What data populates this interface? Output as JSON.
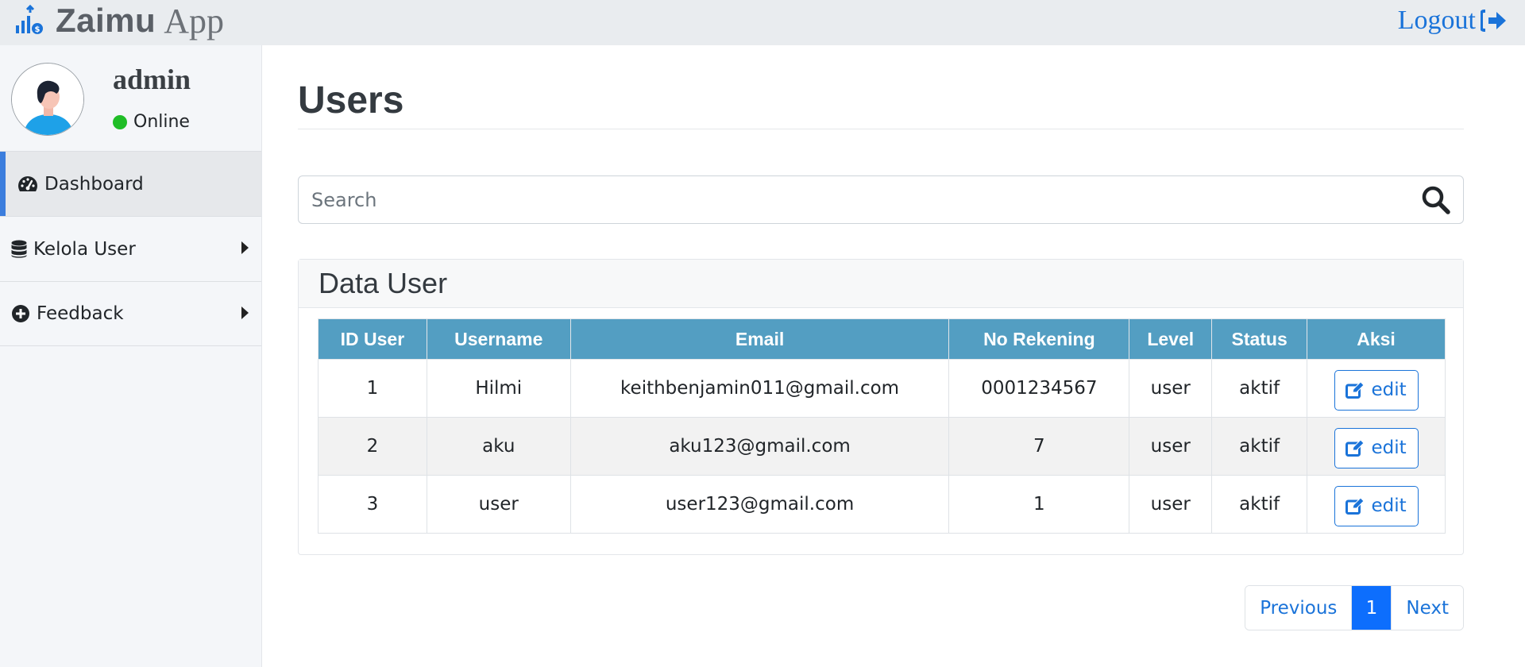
{
  "header": {
    "brand_name": "Zaimu",
    "brand_suffix": "App",
    "logout_label": "Logout"
  },
  "profile": {
    "name": "admin",
    "status": "Online"
  },
  "sidebar": {
    "items": [
      {
        "label": "Dashboard",
        "icon": "dashboard-icon",
        "active": true
      },
      {
        "label": "Kelola User",
        "icon": "database-icon",
        "active": false
      },
      {
        "label": "Feedback",
        "icon": "plus-circle-icon",
        "active": false
      }
    ]
  },
  "main": {
    "title": "Users",
    "search": {
      "placeholder": "Search"
    },
    "card_title": "Data User",
    "table": {
      "headers": [
        "ID User",
        "Username",
        "Email",
        "No Rekening",
        "Level",
        "Status",
        "Aksi"
      ],
      "rows": [
        {
          "id": "1",
          "username": "Hilmi",
          "email": "keithbenjamin011@gmail.com",
          "rekening": "0001234567",
          "level": "user",
          "status": "aktif",
          "action": "edit"
        },
        {
          "id": "2",
          "username": "aku",
          "email": "aku123@gmail.com",
          "rekening": "7",
          "level": "user",
          "status": "aktif",
          "action": "edit"
        },
        {
          "id": "3",
          "username": "user",
          "email": "user123@gmail.com",
          "rekening": "1",
          "level": "user",
          "status": "aktif",
          "action": "edit"
        }
      ]
    },
    "pagination": {
      "previous": "Previous",
      "current": "1",
      "next": "Next"
    }
  },
  "colors": {
    "topbar": "#e9ecef",
    "table_header": "#539ec2",
    "link": "#1a73d9",
    "active_page": "#0d6efd",
    "online": "#1fbd27",
    "sidebar_accent": "#3b7ddd"
  }
}
